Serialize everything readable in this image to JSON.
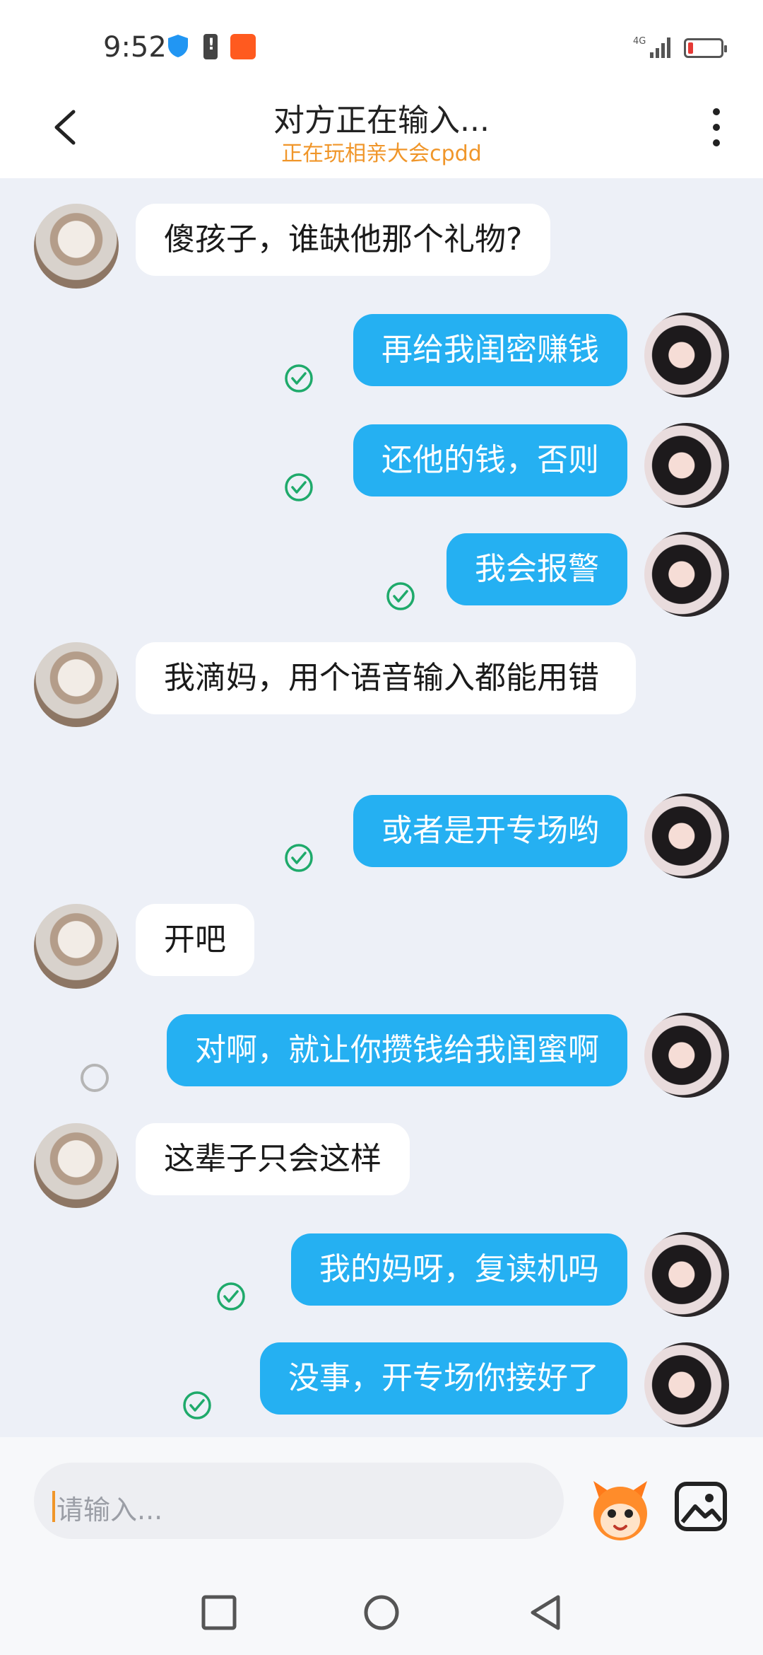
{
  "status_bar": {
    "time": "9:52",
    "icons": [
      "shield-icon",
      "battery-alert-icon",
      "app-notification-icon",
      "signal-4g-icon",
      "battery-low-icon"
    ],
    "network": "4G"
  },
  "header": {
    "title": "对方正在输入...",
    "subtitle": "正在玩相亲大会cpdd",
    "subtitle_color": "#f0962a"
  },
  "colors": {
    "sent_bubble": "#25b0f2",
    "received_bubble": "#ffffff",
    "chat_background": "#edf0f7",
    "read_check": "#1faa6b"
  },
  "messages": [
    {
      "from": "them",
      "text": "傻孩子，谁缺他那个礼物?"
    },
    {
      "from": "me",
      "text": "再给我闺密赚钱",
      "status": "read"
    },
    {
      "from": "me",
      "text": "还他的钱，否则",
      "status": "read"
    },
    {
      "from": "me",
      "text": "我会报警",
      "status": "read"
    },
    {
      "from": "them",
      "text": "我滴妈，用个语音输入都能用错"
    },
    {
      "from": "me",
      "text": "或者是开专场哟",
      "status": "read"
    },
    {
      "from": "them",
      "text": "开吧"
    },
    {
      "from": "me",
      "text": "对啊，就让你攒钱给我闺蜜啊",
      "status": "pending"
    },
    {
      "from": "them",
      "text": "这辈子只会这样"
    },
    {
      "from": "me",
      "text": "我的妈呀，复读机吗",
      "status": "read"
    },
    {
      "from": "me",
      "text": "没事，开专场你接好了",
      "status": "read"
    }
  ],
  "input": {
    "placeholder": "请输入..."
  }
}
